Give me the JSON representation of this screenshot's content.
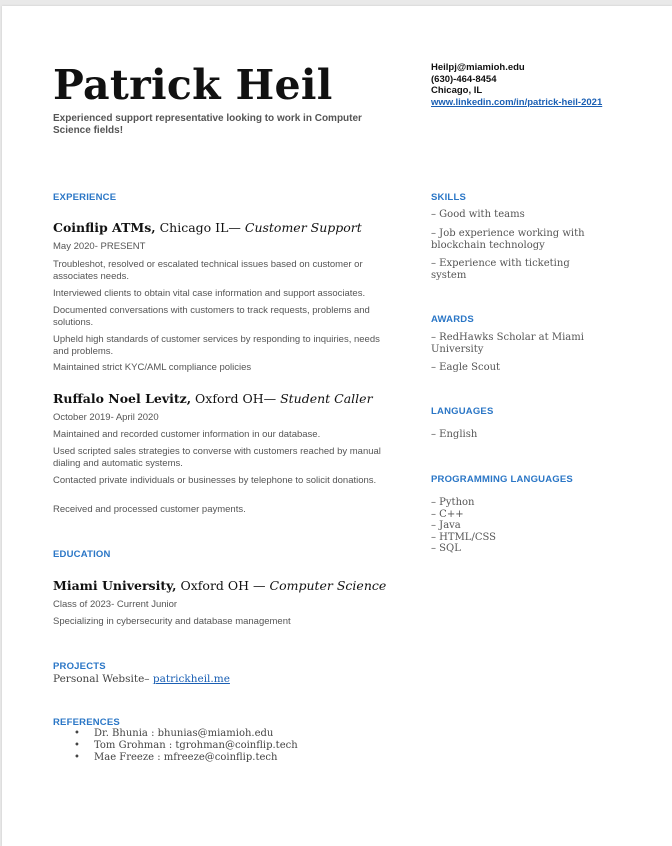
{
  "header": {
    "name": "Patrick Heil",
    "tagline": "Experienced support representative looking to work in Computer Science fields!",
    "email": "Heilpj@miamioh.edu",
    "phone": "(630)-464-8454",
    "location": "Chicago, IL",
    "linkedin": "www.linkedin.com/in/patrick-heil-2021"
  },
  "experience": {
    "heading": "EXPERIENCE",
    "jobs": [
      {
        "company": "Coinflip ATMs,",
        "place": " Chicago IL— ",
        "role": "Customer Support",
        "dates": "May 2020- PRESENT",
        "bullets": [
          "Troubleshot, resolved or escalated technical issues based on customer or associates needs.",
          "Interviewed clients to obtain vital case information and support associates.",
          "Documented conversations with customers to track requests, problems and solutions.",
          "Upheld high standards of customer services by responding to inquiries, needs and problems.",
          "Maintained strict KYC/AML compliance policies"
        ]
      },
      {
        "company": "Ruffalo Noel Levitz,",
        "place": " Oxford OH— ",
        "role": "Student Caller",
        "dates": "October 2019- April 2020",
        "bullets": [
          "Maintained and recorded customer information in our database.",
          "Used scripted sales strategies to converse with customers reached by manual dialing and automatic systems.",
          "Contacted private individuals or businesses by telephone to solicit donations.",
          "Received and processed customer payments."
        ]
      }
    ]
  },
  "education": {
    "heading": "EDUCATION",
    "school": "Miami University,",
    "place": " Oxford OH — ",
    "field": "Computer Science",
    "class": "Class of 2023- Current Junior",
    "focus": "Specializing in cybersecurity and database management"
  },
  "projects": {
    "heading": "PROJECTS",
    "label": "Personal Website– ",
    "link": "patrickheil.me"
  },
  "references": {
    "heading": "REFERENCES",
    "items": [
      "Dr. Bhunia : bhunias@miamioh.edu",
      "Tom Grohman : tgrohman@coinflip.tech",
      "Mae Freeze : mfreeze@coinflip.tech"
    ]
  },
  "skills": {
    "heading": "SKILLS",
    "items": [
      "– Good with teams",
      "– Job experience working with blockchain technology",
      "– Experience with ticketing system"
    ]
  },
  "awards": {
    "heading": "AWARDS",
    "items": [
      "– RedHawks Scholar at Miami University",
      "– Eagle Scout"
    ]
  },
  "languages": {
    "heading": "LANGUAGES",
    "items": [
      "– English"
    ]
  },
  "programming": {
    "heading": "PROGRAMMING LANGUAGES",
    "items": [
      "– Python",
      "– C++",
      "– Java",
      "– HTML/CSS",
      "– SQL"
    ]
  },
  "colors": {
    "accent": "#2a76c6",
    "link": "#1a5fb4",
    "body": "#555555"
  }
}
